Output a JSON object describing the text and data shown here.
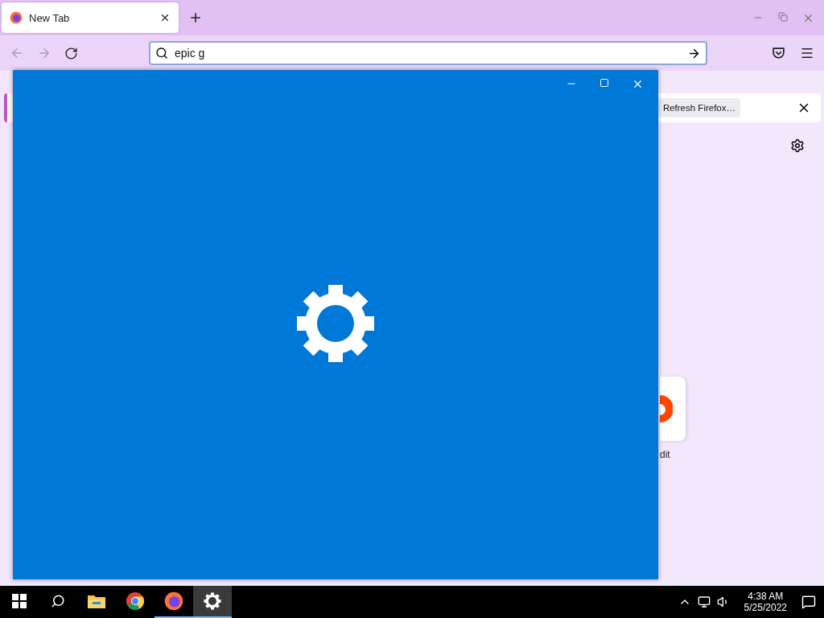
{
  "browser": {
    "tabs": [
      {
        "label": "New Tab",
        "selected": true
      }
    ],
    "address_bar": {
      "value": "epic g"
    },
    "notification": {
      "button": "Refresh Firefox…"
    },
    "shortcuts": [
      {
        "label": "dit"
      }
    ]
  },
  "settings_window": {
    "kind": "splash"
  },
  "taskbar": {
    "apps": [
      {
        "kind": "explorer",
        "running": false,
        "selected": false
      },
      {
        "kind": "chrome",
        "running": false,
        "selected": false
      },
      {
        "kind": "firefox",
        "running": true,
        "selected": false
      },
      {
        "kind": "settings",
        "running": true,
        "selected": true
      }
    ],
    "clock": {
      "time": "4:38 AM",
      "date": "5/25/2022"
    }
  }
}
